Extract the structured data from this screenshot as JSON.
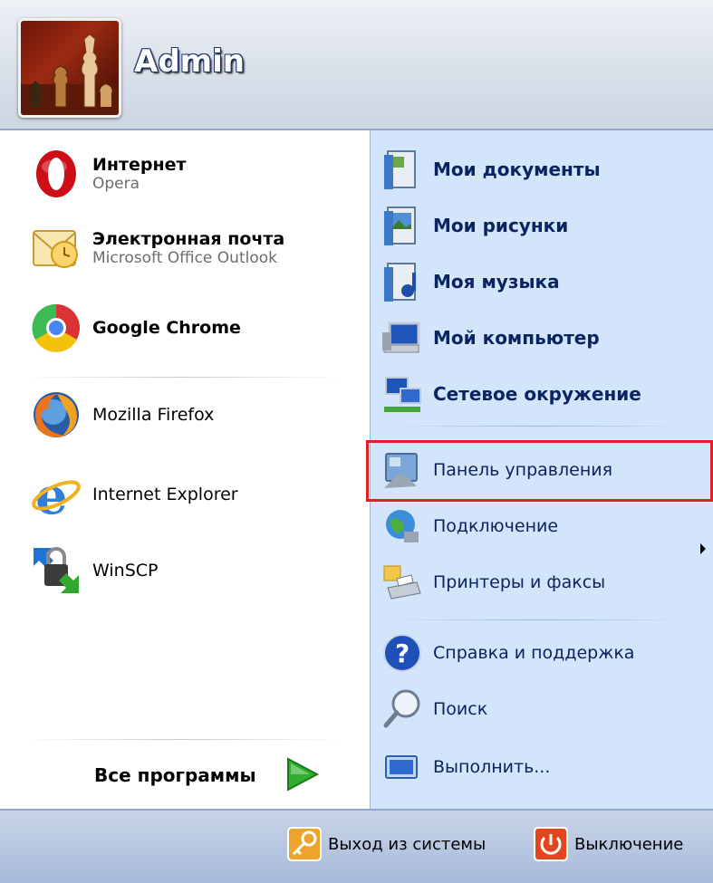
{
  "user": {
    "name": "Admin"
  },
  "pinned": [
    {
      "title": "Интернет",
      "subtitle": "Opera"
    },
    {
      "title": "Электронная почта",
      "subtitle": "Microsoft Office Outlook"
    },
    {
      "title": "Google Chrome"
    }
  ],
  "recent": [
    {
      "label": "Mozilla Firefox"
    },
    {
      "label": "Internet Explorer"
    },
    {
      "label": "WinSCP"
    }
  ],
  "all_programs": "Все программы",
  "places": [
    {
      "label": "Мои документы"
    },
    {
      "label": "Мои рисунки"
    },
    {
      "label": "Моя музыка"
    },
    {
      "label": "Мой компьютер"
    },
    {
      "label": "Сетевое окружение"
    }
  ],
  "system": [
    {
      "label": "Панель управления"
    },
    {
      "label": "Подключение"
    },
    {
      "label": "Принтеры и факсы"
    }
  ],
  "help": [
    {
      "label": "Справка и поддержка"
    },
    {
      "label": "Поиск"
    },
    {
      "label": "Выполнить..."
    }
  ],
  "footer": {
    "logoff": "Выход из системы",
    "shutdown": "Выключение"
  },
  "colors": {
    "highlight": "#e41e26",
    "right_panel": "#d3e5fa",
    "link_text": "#0a2462"
  }
}
